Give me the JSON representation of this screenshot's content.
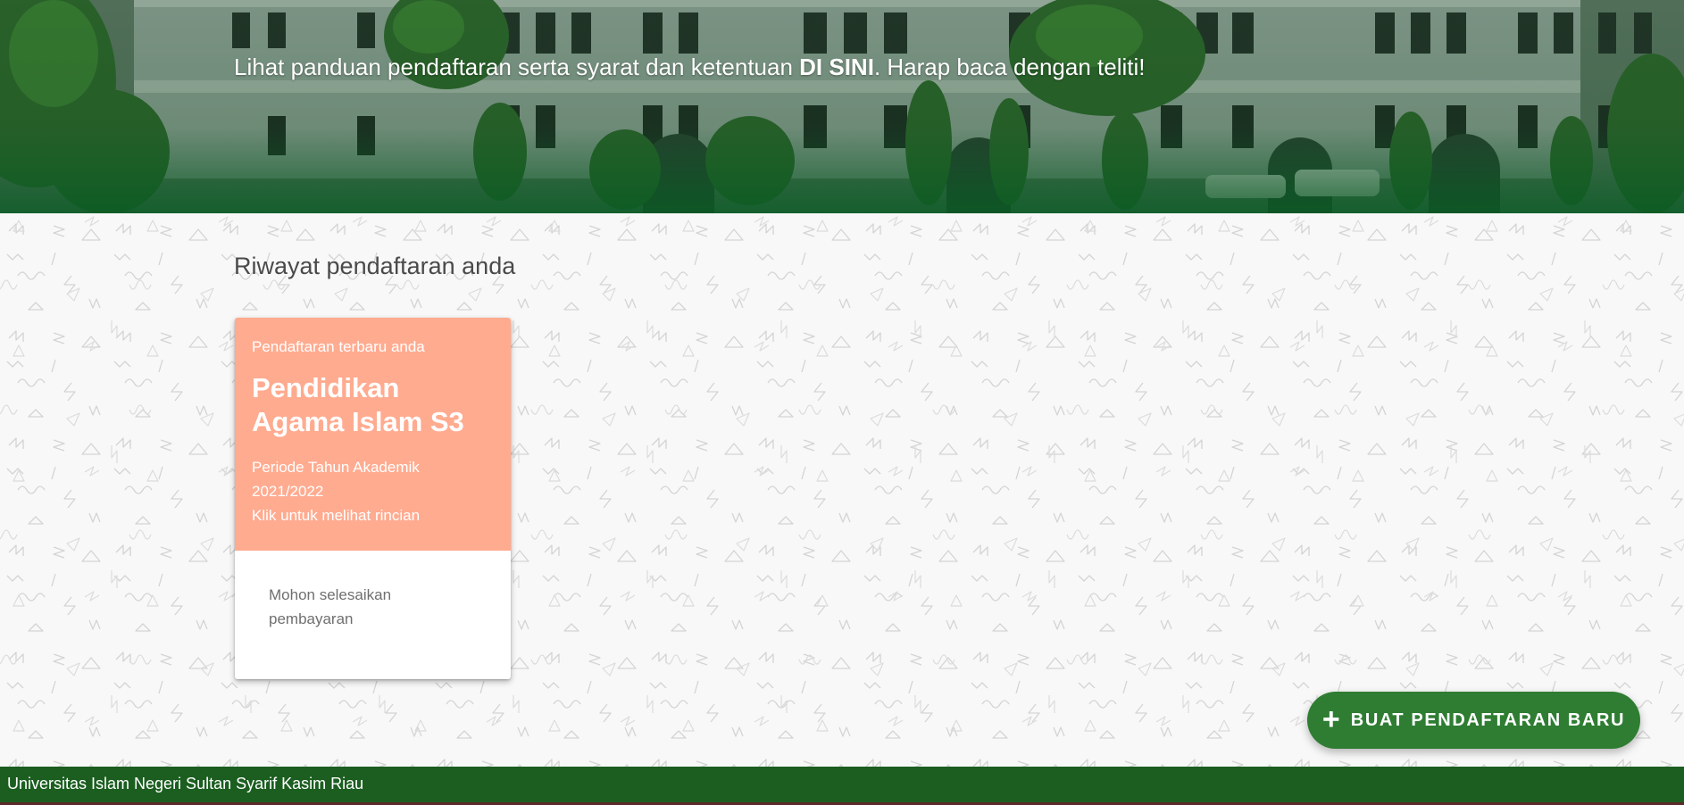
{
  "banner": {
    "guide_prefix": "Lihat panduan pendaftaran serta syarat dan ketentuan ",
    "guide_link": "DI SINI",
    "guide_suffix": ". Harap baca dengan teliti!"
  },
  "history": {
    "title": "Riwayat pendaftaran anda",
    "card": {
      "eyebrow": "Pendaftaran terbaru anda",
      "program": "Pendidikan Agama Islam S3",
      "period_line1": "Periode Tahun Akademik",
      "period_line2": "2021/2022",
      "hint": "Klik untuk melihat rincian",
      "status": "Mohon selesaikan pembayaran",
      "color": "#ffab90"
    }
  },
  "fab": {
    "icon": "plus-icon",
    "label": "BUAT PENDAFTARAN BARU",
    "color": "#2e7d32"
  },
  "footer": {
    "text": "Universitas Islam Negeri Sultan Syarif Kasim Riau",
    "color": "#1b5e20"
  }
}
